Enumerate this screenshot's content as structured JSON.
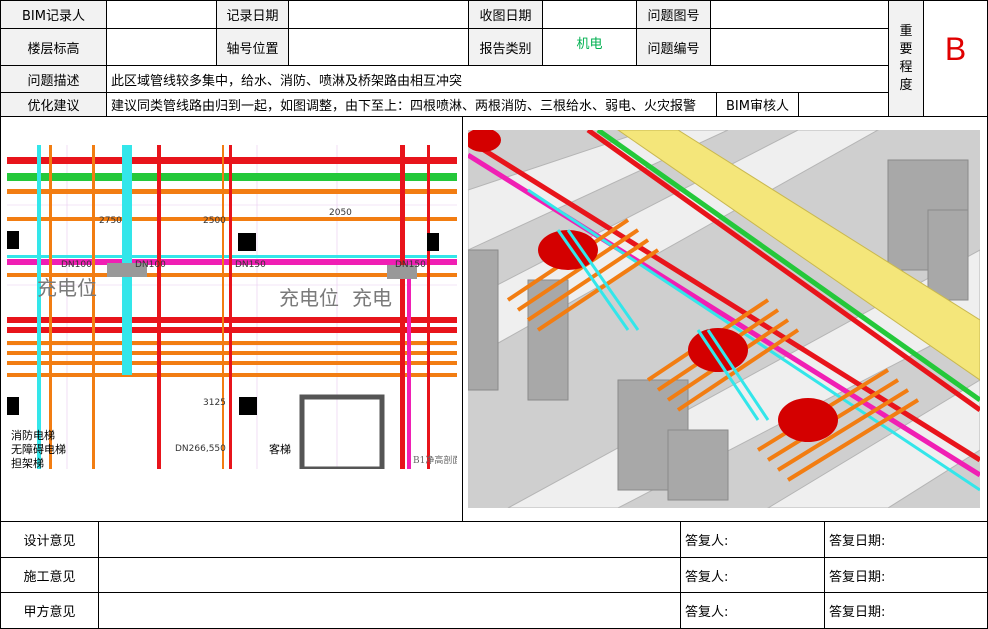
{
  "header": {
    "recorder_label": "BIM记录人",
    "record_date_label": "记录日期",
    "receive_date_label": "收图日期",
    "problem_drawing_label": "问题图号",
    "floor_elev_label": "楼层标高",
    "axis_label": "轴号位置",
    "report_type_label": "报告类别",
    "report_type_value": "机电",
    "problem_no_label": "问题编号",
    "importance_label": [
      "重",
      "要",
      "程",
      "度"
    ],
    "importance_value": "B",
    "desc_label": "问题描述",
    "desc_value": "此区域管线较多集中，给水、消防、喷淋及桥架路由相互冲突",
    "suggest_label": "优化建议",
    "suggest_value": "建议同类管线路由归到一起，如图调整，由下至上：四根喷淋、两根消防、三根给水、弱电、火灾报警",
    "reviewer_label": "BIM审核人"
  },
  "plan": {
    "dims": [
      "2750",
      "2500",
      "2050",
      "3125",
      "DN25",
      "DN32",
      "DN100",
      "DN150"
    ],
    "room_labels": [
      "充电位",
      "充电位",
      "充电",
      "消防电梯",
      "无障碍电梯",
      "担架梯",
      "客梯",
      "B1净高剖面"
    ],
    "pipe_tags": [
      "DN100",
      "DN100",
      "DN150",
      "DN150",
      "DN266,550"
    ]
  },
  "footer": [
    {
      "label": "设计意见",
      "reply_label": "答复人:",
      "date_label": "答复日期:"
    },
    {
      "label": "施工意见",
      "reply_label": "答复人:",
      "date_label": "答复日期:"
    },
    {
      "label": "甲方意见",
      "reply_label": "答复人:",
      "date_label": "答复日期:"
    }
  ],
  "colors": {
    "red": "#e8141b",
    "green": "#24c83a",
    "orange": "#f27d12",
    "cyan": "#33e6ea",
    "magenta": "#f01fb4",
    "yellow": "#f4e67a",
    "gray": "#bfbfbf"
  }
}
